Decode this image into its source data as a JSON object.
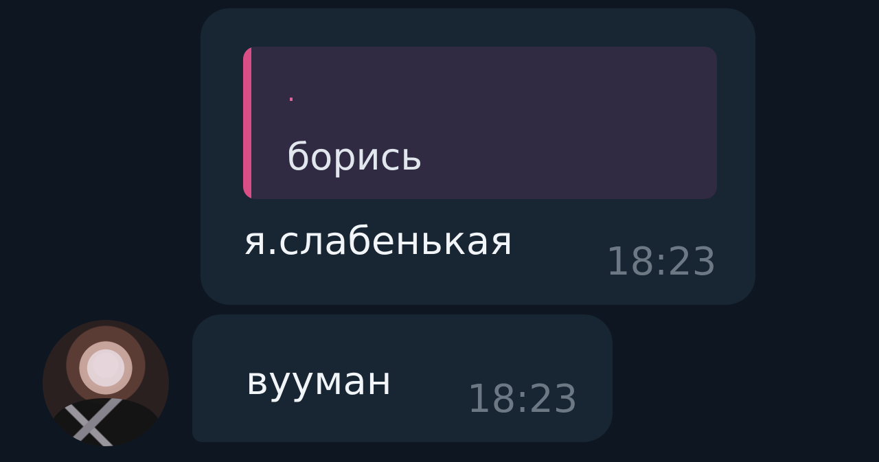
{
  "messages": [
    {
      "reply": {
        "author": "·",
        "text": "борись"
      },
      "text": "я.слабенькая",
      "time": "18:23"
    },
    {
      "text": "вууман",
      "time": "18:23",
      "avatar": "user-avatar"
    }
  ],
  "colors": {
    "background": "#0e1621",
    "bubble": "#182533",
    "reply_background": "#302b43",
    "reply_accent": "#d94f85",
    "message_text": "#f2f5f8",
    "time_text": "#6c7883"
  }
}
